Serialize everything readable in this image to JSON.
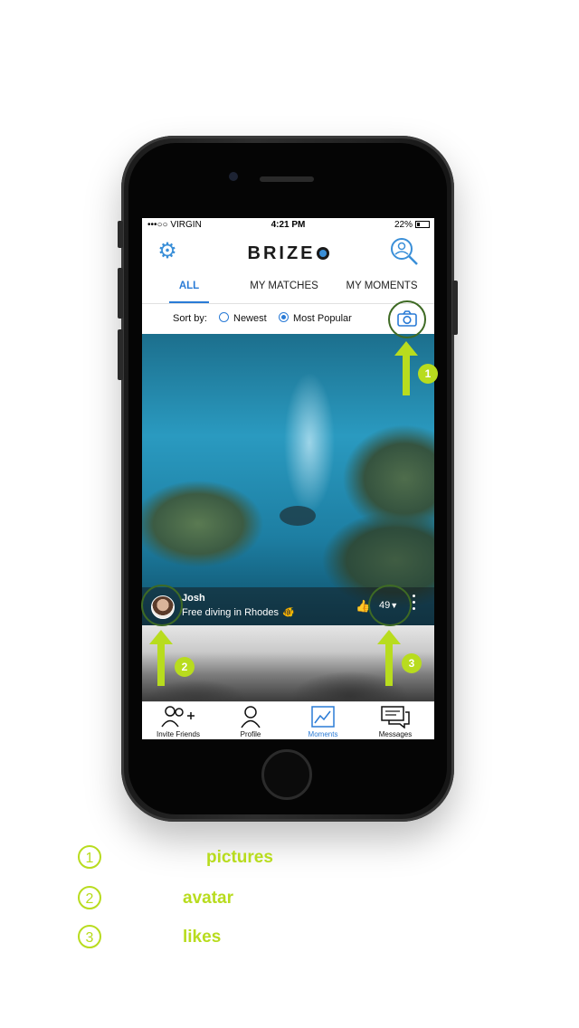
{
  "status_bar": {
    "carrier": "•••○○ VIRGIN",
    "time": "4:21 PM",
    "battery": "22%"
  },
  "header": {
    "logo": "BRIZE"
  },
  "tabs": [
    {
      "label": "ALL",
      "active": true
    },
    {
      "label": "MY MATCHES",
      "active": false
    },
    {
      "label": "MY MOMENTS",
      "active": false
    }
  ],
  "sort": {
    "label": "Sort by:",
    "options": [
      {
        "label": "Newest",
        "selected": false
      },
      {
        "label": "Most Popular",
        "selected": true
      }
    ]
  },
  "post": {
    "user": "Josh",
    "caption": "Free diving in Rhodes",
    "likes": "49"
  },
  "bottom_nav": [
    {
      "label": "Invite Friends",
      "icon": "invite-friends-icon"
    },
    {
      "label": "Profile",
      "icon": "profile-icon"
    },
    {
      "label": "Moments",
      "icon": "moments-icon",
      "active": true
    },
    {
      "label": "Messages",
      "icon": "messages-icon"
    }
  ],
  "annotations": [
    {
      "number": "1",
      "label": "pictures"
    },
    {
      "number": "2",
      "label": "avatar"
    },
    {
      "number": "3",
      "label": "likes"
    }
  ],
  "colors": {
    "accent": "#2a7bd6",
    "highlight": "#b8dc1e",
    "ring": "#3e6a24"
  }
}
